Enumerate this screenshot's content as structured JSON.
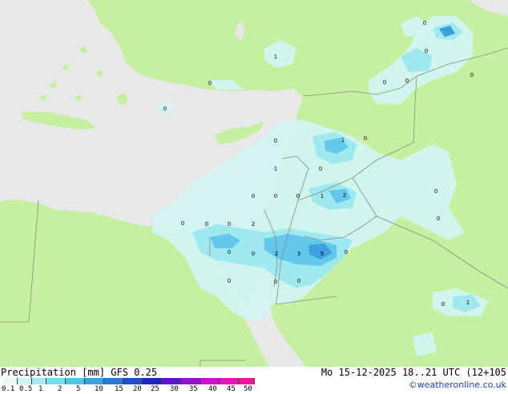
{
  "map": {
    "colors": {
      "land": "#c4f0a0",
      "sea": "#e8e8e8",
      "border": "#888888",
      "precip_light": "#d2f5f5",
      "precip_mid": "#9ee8f0",
      "precip_heavy": "#64c8ec",
      "precip_max": "#3ca0dc"
    },
    "values": [
      {
        "text": "0"
      },
      {
        "text": "1"
      },
      {
        "text": "0"
      },
      {
        "text": "0"
      },
      {
        "text": "0"
      },
      {
        "text": "0"
      },
      {
        "text": "0"
      },
      {
        "text": "0"
      },
      {
        "text": "1"
      },
      {
        "text": "0"
      },
      {
        "text": "1"
      },
      {
        "text": "0"
      },
      {
        "text": "0"
      },
      {
        "text": "0"
      },
      {
        "text": "0"
      },
      {
        "text": "1"
      },
      {
        "text": "2"
      },
      {
        "text": "0"
      },
      {
        "text": "0"
      },
      {
        "text": "0"
      },
      {
        "text": "0"
      },
      {
        "text": "0"
      },
      {
        "text": "0"
      },
      {
        "text": "2"
      },
      {
        "text": "0"
      },
      {
        "text": "2"
      },
      {
        "text": "3"
      },
      {
        "text": "5"
      },
      {
        "text": "0"
      },
      {
        "text": "0"
      },
      {
        "text": "0"
      },
      {
        "text": "0"
      },
      {
        "text": "0"
      },
      {
        "text": "1"
      },
      {
        "text": "0"
      }
    ]
  },
  "footer": {
    "title": "Precipitation [mm] GFS 0.25",
    "datetime": "Mo 15-12-2025 18..21 UTC (12+105",
    "copyright": "©weatheronline.co.uk"
  },
  "legend": {
    "labels": [
      "0.1",
      "0.5",
      "1",
      "2",
      "5",
      "10",
      "15",
      "20",
      "25",
      "30",
      "35",
      "40",
      "45",
      "50"
    ],
    "colors": [
      "#e8fafa",
      "#c8f4f4",
      "#a0ecf0",
      "#78dcec",
      "#50c4e8",
      "#3ca0dc",
      "#2878d0",
      "#1e50c8",
      "#1e28b4",
      "#6414c8",
      "#9614c8",
      "#c814c8",
      "#e614b4",
      "#f01496"
    ]
  }
}
